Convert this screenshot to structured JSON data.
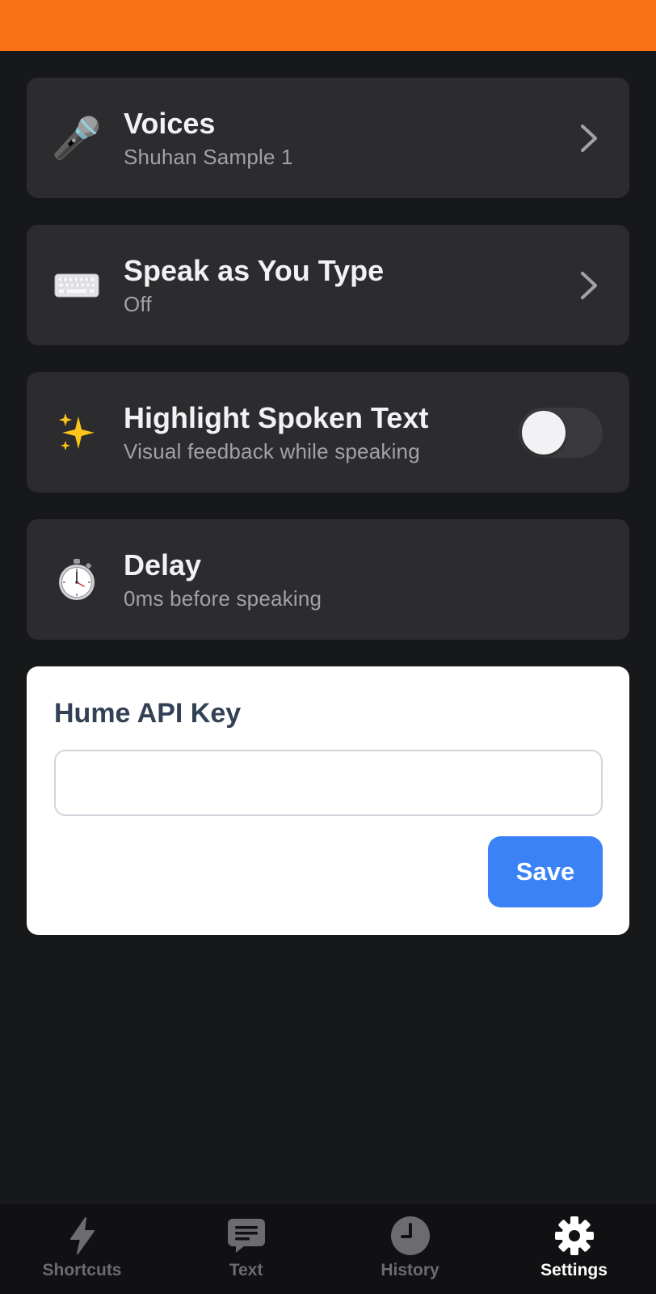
{
  "colors": {
    "top_bar": "#f97316",
    "background": "#17181a",
    "card": "#2c2c2e",
    "accent_blue": "#3b82f6",
    "tab_inactive": "#6b6b70",
    "tab_active": "#ffffff"
  },
  "settings": [
    {
      "icon": "microphone-icon",
      "glyph": "🎤",
      "title": "Voices",
      "subtitle": "Shuhan Sample 1",
      "control": "chevron"
    },
    {
      "icon": "keyboard-icon",
      "glyph": "⌨️",
      "title": "Speak as You Type",
      "subtitle": "Off",
      "control": "chevron"
    },
    {
      "icon": "sparkles-icon",
      "glyph": "✨",
      "title": "Highlight Spoken Text",
      "subtitle": "Visual feedback while speaking",
      "control": "toggle",
      "toggle_on": false
    },
    {
      "icon": "stopwatch-icon",
      "glyph": "⏱️",
      "title": "Delay",
      "subtitle": "0ms before speaking",
      "control": "none"
    }
  ],
  "api_key": {
    "title": "Hume API Key",
    "value": "",
    "placeholder": "",
    "save_label": "Save"
  },
  "tabs": [
    {
      "label": "Shortcuts",
      "icon": "lightning-icon",
      "active": false
    },
    {
      "label": "Text",
      "icon": "chat-bubble-icon",
      "active": false
    },
    {
      "label": "History",
      "icon": "clock-icon",
      "active": false
    },
    {
      "label": "Settings",
      "icon": "gear-icon",
      "active": true
    }
  ]
}
